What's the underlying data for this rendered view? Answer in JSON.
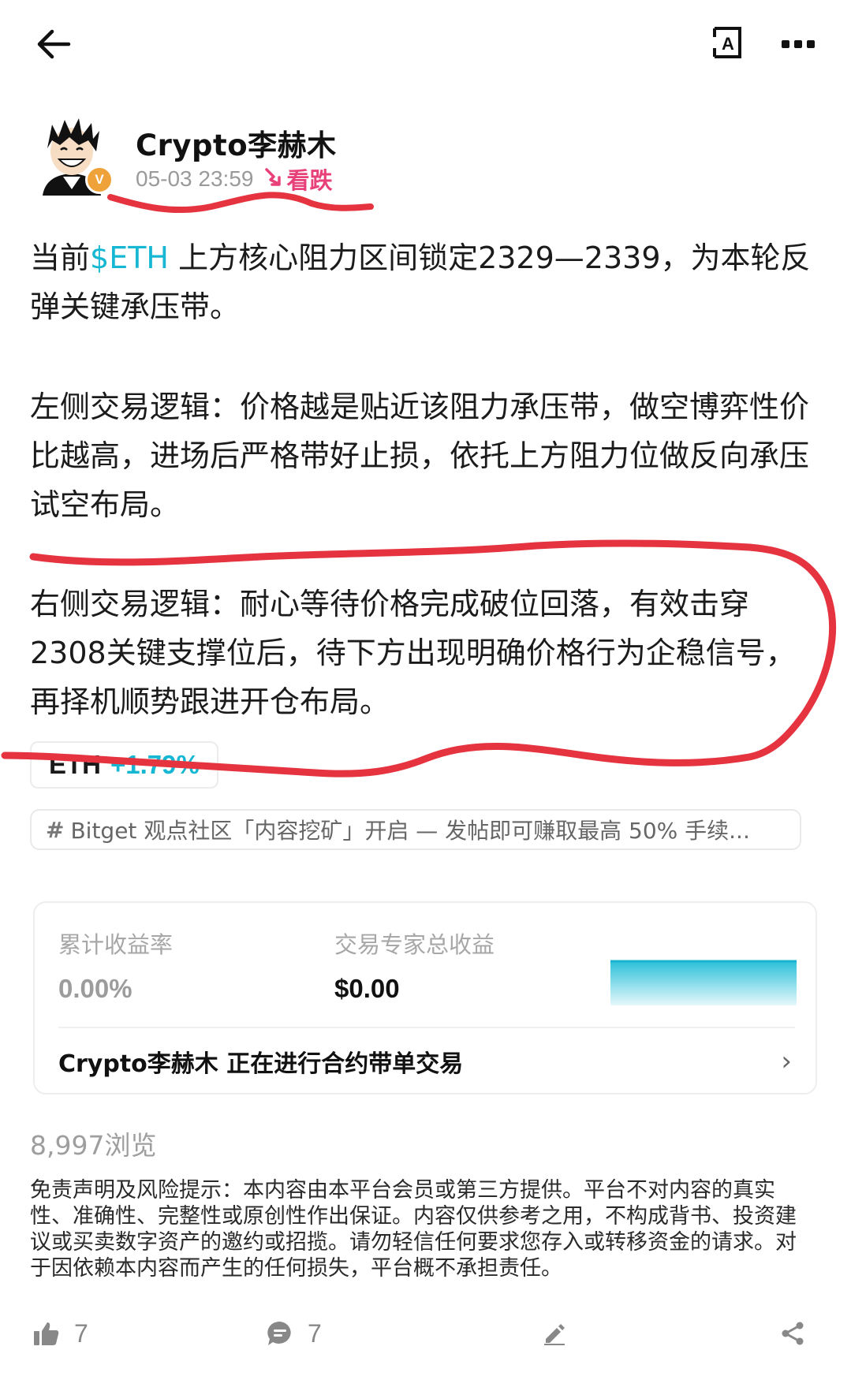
{
  "icons": {
    "back": "arrow-left-icon",
    "translate": "translate-icon",
    "more": "more-horizontal-icon",
    "bearish": "trend-down-icon",
    "like": "thumbs-up-icon",
    "comment": "comment-icon",
    "edit": "pencil-icon",
    "share": "share-icon"
  },
  "author": {
    "name": "Crypto李赫木",
    "verified_badge": "V",
    "timestamp": "05-03 23:59",
    "sentiment": "看跌"
  },
  "post": {
    "p1_prefix": "当前",
    "p1_cashtag": "$ETH",
    "p1_suffix": " 上方核心阻力区间锁定2329—2339，为本轮反弹关键承压带。",
    "p2": "左侧交易逻辑：价格越是贴近该阻力承压带，做空博弈性价比越高，进场后严格带好止损，依托上方阻力位做反向承压试空布局。",
    "p3": "右侧交易逻辑：耐心等待价格完成破位回落，有效击穿2308关键支撑位后，待下方出现明确价格行为企稳信号，再择机顺势跟进开仓布局。"
  },
  "coin_tag": {
    "symbol": "ETH",
    "change": "+1.79%"
  },
  "topic": {
    "hash": "#",
    "text": "Bitget 观点社区「内容挖矿」开启 — 发帖即可赚取最高 50% 手续..."
  },
  "trader_card": {
    "roi_label": "累计收益率",
    "roi_value": "0.00%",
    "profit_label": "交易专家总收益",
    "profit_value": "$0.00",
    "copy_text": "Crypto李赫木 正在进行合约带单交易",
    "chevron": "›"
  },
  "views": "8,997浏览",
  "disclaimer": "免责声明及风险提示：本内容由本平台会员或第三方提供。平台不对内容的真实性、准确性、完整性或原创性作出保证。内容仅供参考之用，不构成背书、投资建议或买卖数字资产的邀约或招揽。请勿轻信任何要求您存入或转移资金的请求。对于因依赖本内容而产生的任何损失，平台概不承担责任。",
  "actions": {
    "likes": "7",
    "comments": "7"
  },
  "colors": {
    "accent": "#16b7d3",
    "bearish": "#e8417a",
    "marker": "#e5333f"
  }
}
